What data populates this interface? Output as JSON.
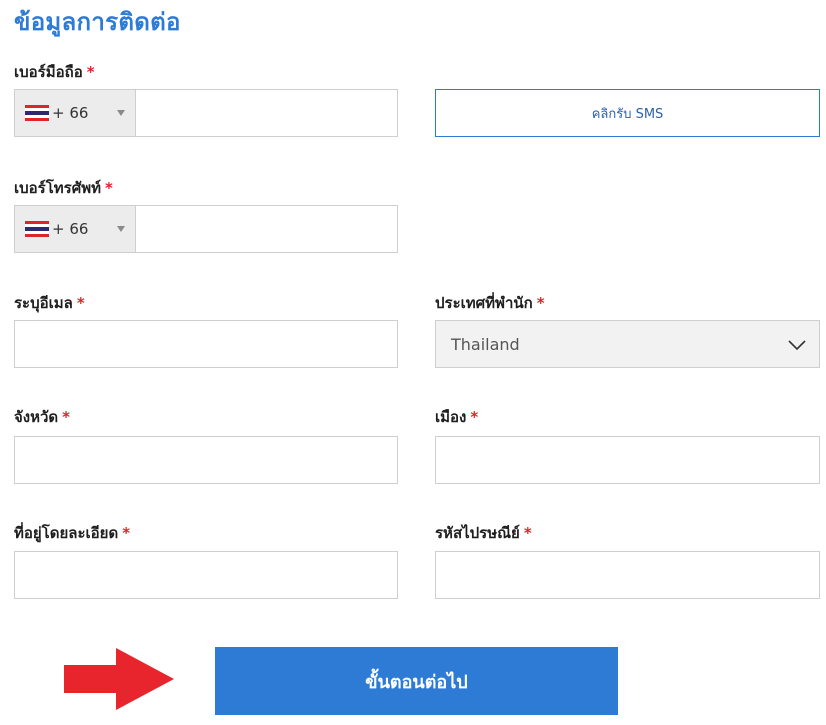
{
  "section_title": "ข้อมูลการติดต่อ",
  "required_mark": "*",
  "mobile": {
    "label": "เบอร์มือถือ",
    "country_code": "+ 66",
    "value": ""
  },
  "sms_button_label": "คลิกรับ SMS",
  "telephone": {
    "label": "เบอร์โทรศัพท์",
    "country_code": "+ 66",
    "value": ""
  },
  "email": {
    "label": "ระบุอีเมล",
    "value": ""
  },
  "country": {
    "label": "ประเทศที่พำนัก",
    "selected": "Thailand"
  },
  "province": {
    "label": "จังหวัด",
    "value": ""
  },
  "city": {
    "label": "เมือง",
    "value": ""
  },
  "address": {
    "label": "ที่อยู่โดยละเอียด",
    "value": ""
  },
  "postal_code": {
    "label": "รหัสไปรษณีย์",
    "value": ""
  },
  "next_button_label": "ขั้นตอนต่อไป",
  "colors": {
    "accent": "#2e7bd6",
    "required": "#e0242a",
    "arrow": "#e8242c"
  },
  "icons": {
    "flag": "thai-flag-icon",
    "caret": "caret-down-icon",
    "select": "chevron-down-icon",
    "pointer": "red-arrow-icon"
  }
}
